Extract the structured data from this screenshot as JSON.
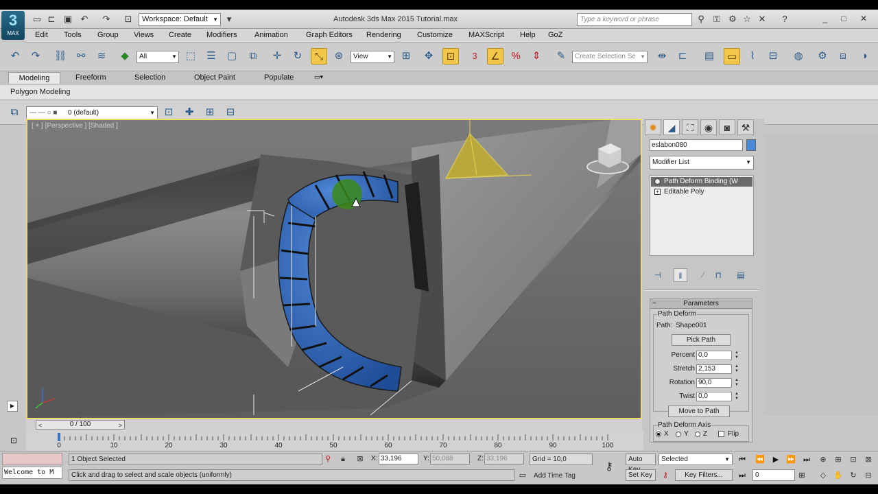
{
  "titlebar": {
    "logo_label": "MAX",
    "workspace": "Workspace: Default",
    "title": "Autodesk 3ds Max  2015    Tutorial.max",
    "search_placeholder": "Type a keyword or phrase"
  },
  "menu": [
    "Edit",
    "Tools",
    "Group",
    "Views",
    "Create",
    "Modifiers",
    "Animation",
    "Graph Editors",
    "Rendering",
    "Customize",
    "MAXScript",
    "Help",
    "GoZ"
  ],
  "toolbar": {
    "filter": "All",
    "ref_coord": "View",
    "snap_label": "3",
    "selection_set": "Create Selection Se"
  },
  "ribbon": {
    "tabs": [
      "Modeling",
      "Freeform",
      "Selection",
      "Object Paint",
      "Populate"
    ],
    "active_tab": "Modeling",
    "sub_label": "Polygon Modeling",
    "layer": "0 (default)"
  },
  "viewport": {
    "label": "[ + ] [Perspective ] [Shaded ]"
  },
  "command_panel": {
    "object_name": "eslabon080",
    "object_color": "#4a88d8",
    "modifier_list": "Modifier List",
    "stack": [
      "Path Deform Binding (W",
      "Editable Poly"
    ],
    "rollout_title": "Parameters",
    "group_path_deform": "Path Deform",
    "path_label": "Path:",
    "path_value": "Shape001",
    "pick_path": "Pick Path",
    "params": [
      {
        "label": "Percent",
        "value": "0,0"
      },
      {
        "label": "Stretch",
        "value": "2,153"
      },
      {
        "label": "Rotation",
        "value": "90,0"
      },
      {
        "label": "Twist",
        "value": "0,0"
      }
    ],
    "move_to_path": "Move to Path",
    "group_axis": "Path Deform Axis",
    "axes": [
      "X",
      "Y",
      "Z"
    ],
    "flip": "Flip"
  },
  "timeline": {
    "frame": "0 / 100",
    "ticks": [
      "0",
      "10",
      "20",
      "30",
      "40",
      "50",
      "60",
      "70",
      "80",
      "90",
      "100"
    ]
  },
  "statusbar": {
    "maxscript_text": "Welcome to M",
    "selection_info": "1 Object Selected",
    "prompt": "Click and drag to select and scale objects (uniformly)",
    "x_label": "X:",
    "x_value": "33,196",
    "y_label": "Y:",
    "y_value": "50,088",
    "z_label": "Z:",
    "z_value": "33,196",
    "grid": "Grid = 10,0",
    "add_time_tag": "Add Time Tag",
    "auto_key": "Auto Key",
    "set_key": "Set Key",
    "selected": "Selected",
    "key_filters": "Key Filters...",
    "frame_field": "0"
  },
  "colors": {
    "viewport_border": "#ece25e",
    "active_tool": "#f3c84a",
    "link_blue": "#3a72c8"
  }
}
